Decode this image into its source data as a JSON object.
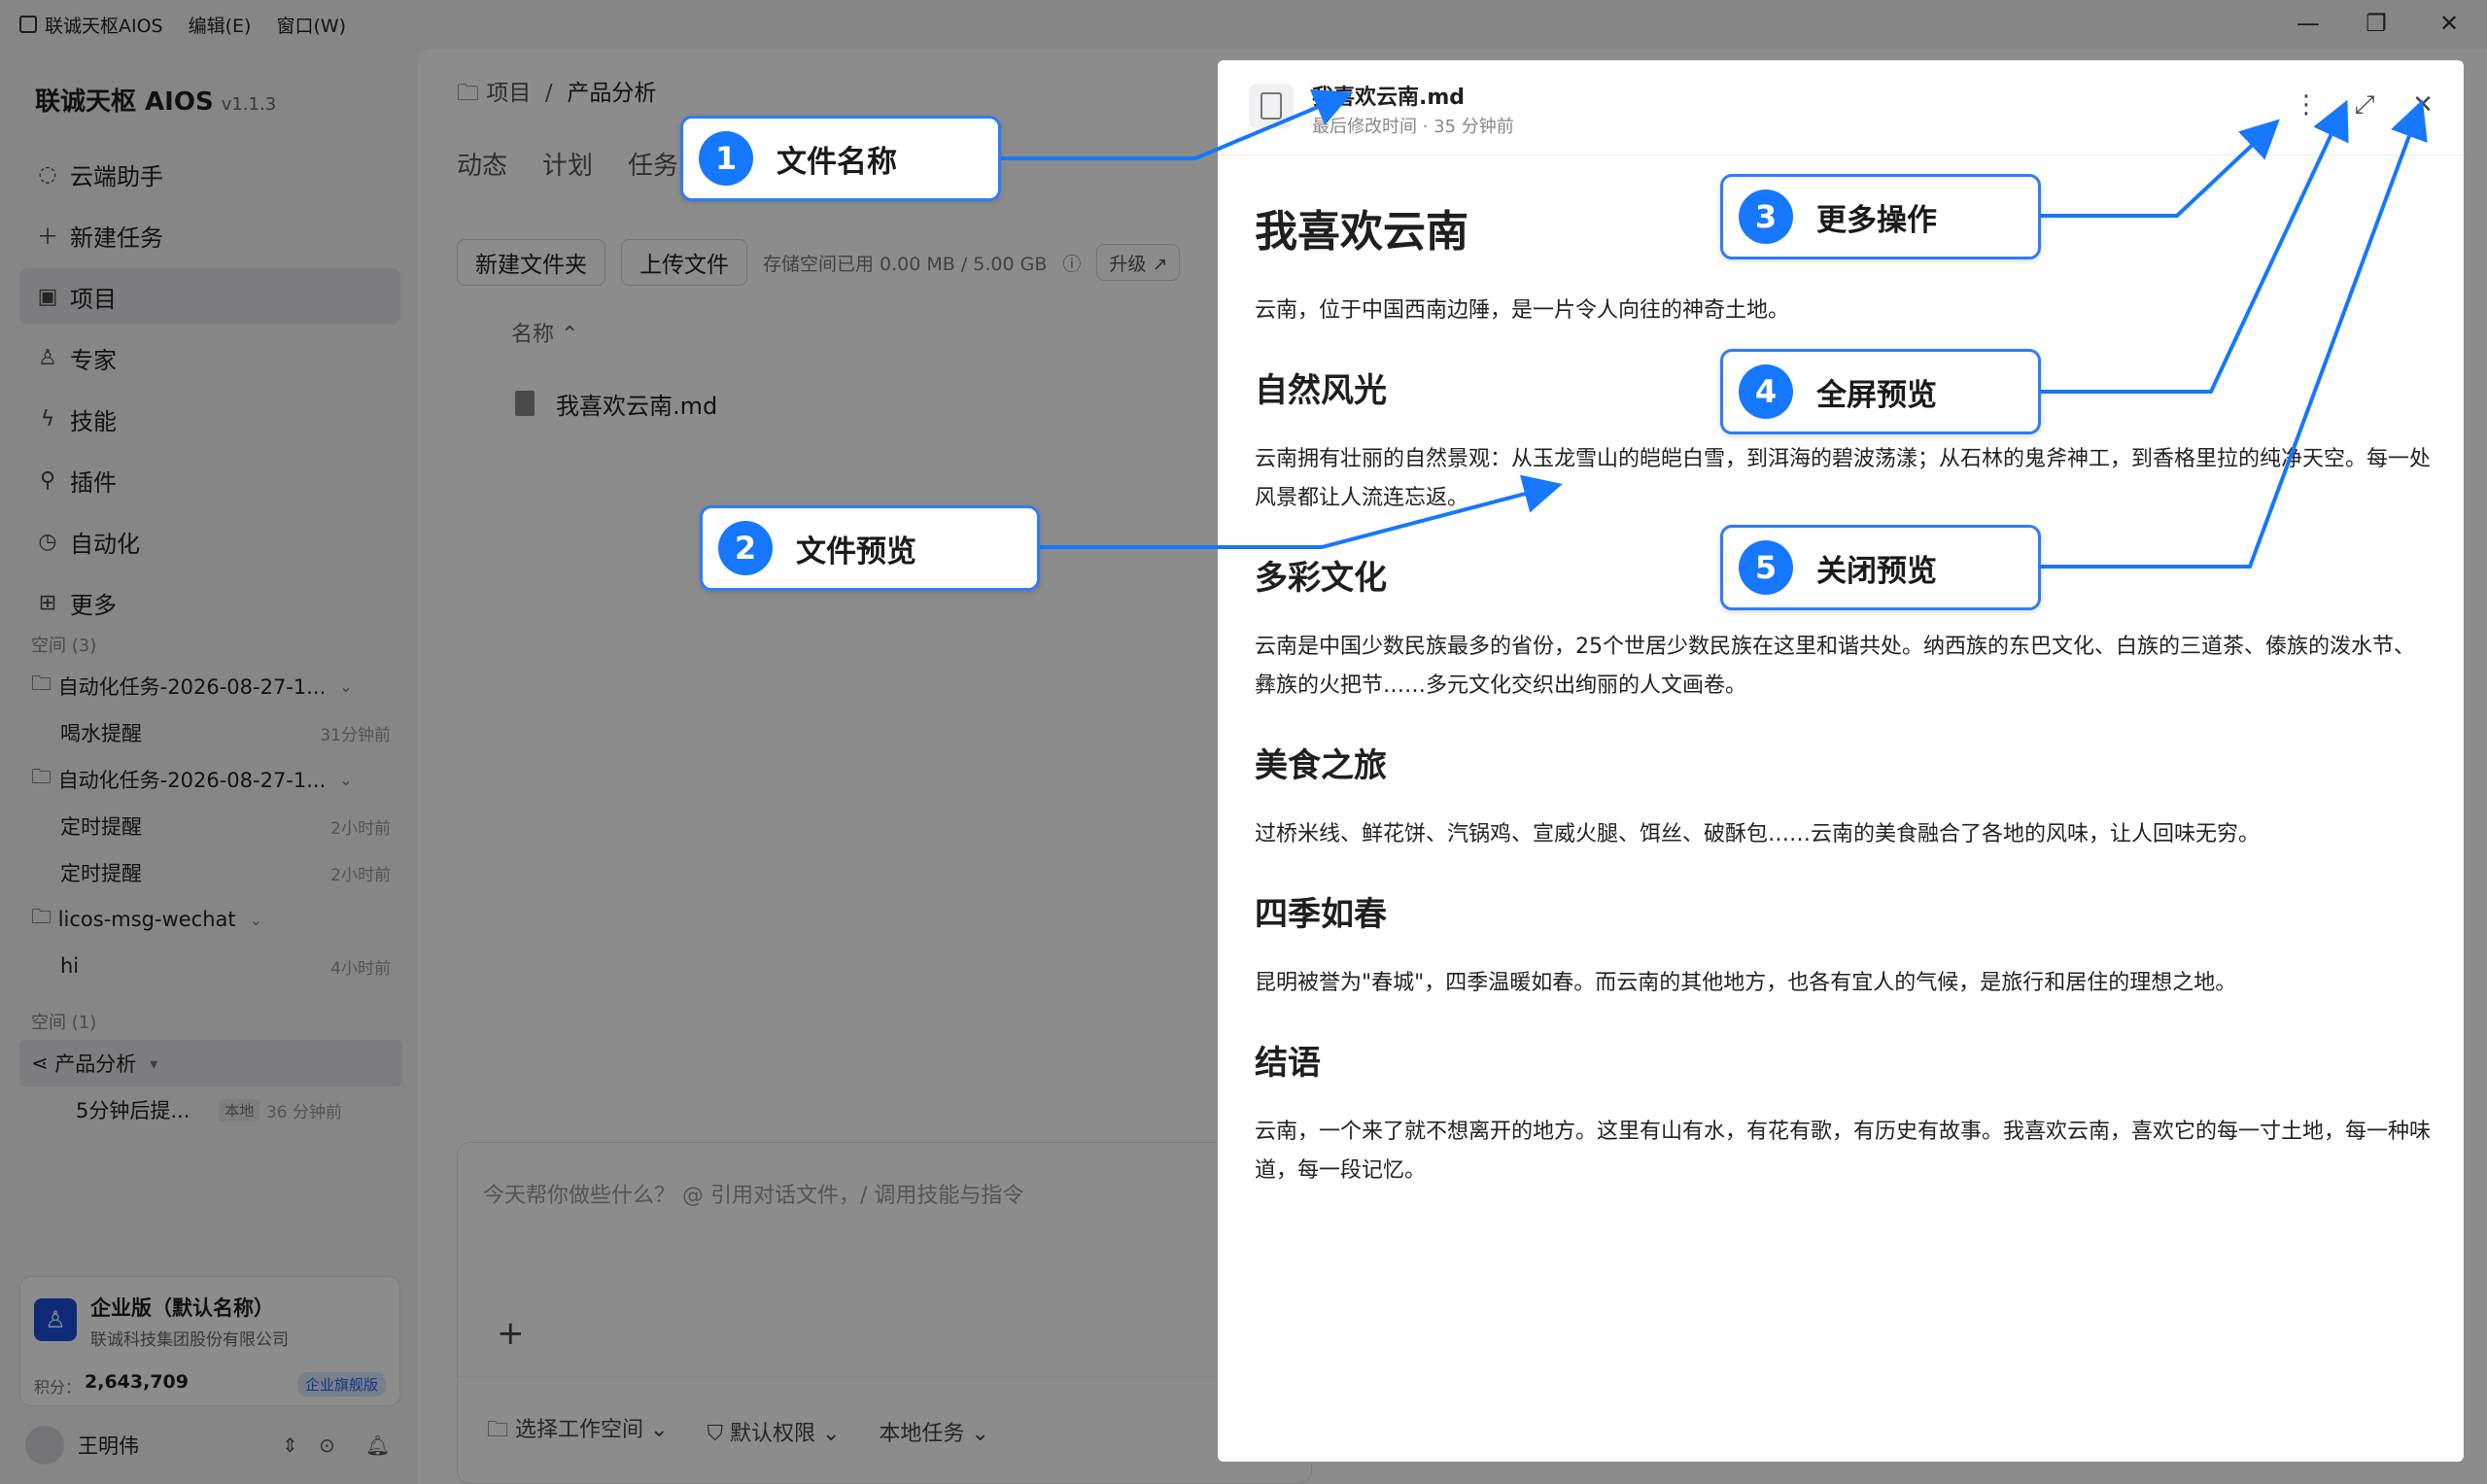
{
  "menubar": {
    "app_name": "联诚天枢AIOS",
    "edit": "编辑(E)",
    "window": "窗口(W)"
  },
  "window_controls": {
    "minimize": "—",
    "restore": "❐",
    "close": "✕"
  },
  "sidebar": {
    "brand": "联诚天枢 AIOS",
    "version": "v1.1.3",
    "nav": [
      {
        "label": "云端助手",
        "icon": "chat-icon"
      },
      {
        "label": "新建任务",
        "icon": "plus-icon"
      },
      {
        "label": "项目",
        "icon": "project-icon"
      },
      {
        "label": "专家",
        "icon": "expert-icon"
      },
      {
        "label": "技能",
        "icon": "bolt-icon"
      },
      {
        "label": "插件",
        "icon": "plugin-icon"
      },
      {
        "label": "自动化",
        "icon": "clock-icon"
      },
      {
        "label": "更多",
        "icon": "grid-icon"
      }
    ],
    "space_label_1": "空间 (3)",
    "space_label_2": "空间 (1)",
    "tree": [
      {
        "label": "自动化任务-2026-08-27-1...",
        "type": "folder"
      },
      {
        "label": "喝水提醒",
        "time": "31分钟前"
      },
      {
        "label": "自动化任务-2026-08-27-1...",
        "type": "folder"
      },
      {
        "label": "定时提醒",
        "time": "2小时前"
      },
      {
        "label": "定时提醒",
        "time": "2小时前"
      },
      {
        "label": "licos-msg-wechat",
        "type": "folder"
      },
      {
        "label": "hi",
        "time": "4小时前"
      }
    ],
    "project": {
      "label": "产品分析",
      "child": "5分钟后提...",
      "tag": "本地",
      "time": "36 分钟前"
    }
  },
  "org": {
    "name": "企业版（默认名称）",
    "company": "联诚科技集团股份有限公司",
    "points_label": "积分：",
    "points": "2,643,709",
    "badge": "企业旗舰版"
  },
  "user": {
    "name": "王明伟"
  },
  "main": {
    "breadcrumb_root": "项目",
    "breadcrumb_current": "产品分析",
    "tabs": [
      "动态",
      "计划",
      "任务"
    ],
    "new_folder": "新建文件夹",
    "upload": "上传文件",
    "storage": "存储空间已用 0.00 MB / 5.00 GB",
    "upgrade": "升级 ↗",
    "col_name": "名称",
    "file_name": "我喜欢云南.md",
    "chat_placeholder": "今天帮你做些什么？ @ 引用对话文件，/ 调用技能与指令",
    "chat_foot": [
      "选择工作空间",
      "默认权限",
      "本地任务"
    ]
  },
  "preview": {
    "file_name": "我喜欢云南.md",
    "meta": "最后修改时间 · 35 分钟前",
    "h1": "我喜欢云南",
    "intro": "云南，位于中国西南边陲，是一片令人向往的神奇土地。",
    "sections": [
      {
        "h": "自然风光",
        "p": "云南拥有壮丽的自然景观：从玉龙雪山的皑皑白雪，到洱海的碧波荡漾；从石林的鬼斧神工，到香格里拉的纯净天空。每一处风景都让人流连忘返。"
      },
      {
        "h": "多彩文化",
        "p": "云南是中国少数民族最多的省份，25个世居少数民族在这里和谐共处。纳西族的东巴文化、白族的三道茶、傣族的泼水节、彝族的火把节……多元文化交织出绚丽的人文画卷。"
      },
      {
        "h": "美食之旅",
        "p": "过桥米线、鲜花饼、汽锅鸡、宣威火腿、饵丝、破酥包……云南的美食融合了各地的风味，让人回味无穷。"
      },
      {
        "h": "四季如春",
        "p": "昆明被誉为\"春城\"，四季温暖如春。而云南的其他地方，也各有宜人的气候，是旅行和居住的理想之地。"
      },
      {
        "h": "结语",
        "p": "云南，一个来了就不想离开的地方。这里有山有水，有花有歌，有历史有故事。我喜欢云南，喜欢它的每一寸土地，每一种味道，每一段记忆。"
      }
    ]
  },
  "callouts": [
    {
      "num": "1",
      "label": "文件名称"
    },
    {
      "num": "2",
      "label": "文件预览"
    },
    {
      "num": "3",
      "label": "更多操作"
    },
    {
      "num": "4",
      "label": "全屏预览"
    },
    {
      "num": "5",
      "label": "关闭预览"
    }
  ],
  "colors": {
    "accent": "#1677ff",
    "callout_border": "#2f7cf6"
  }
}
